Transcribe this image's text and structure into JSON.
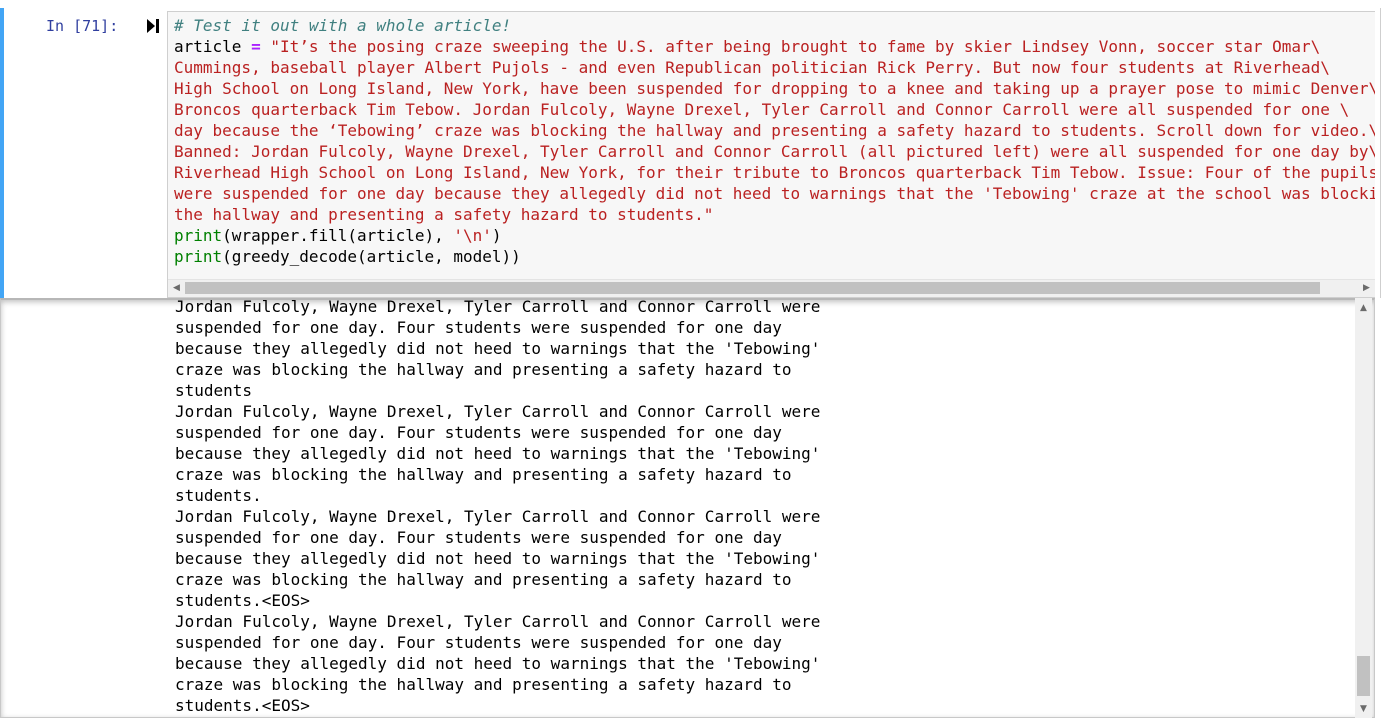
{
  "cell": {
    "prompt": "In [71]:",
    "code_lines": [
      {
        "tokens": [
          {
            "t": "# Test it out with a whole article!",
            "c": "comment"
          }
        ]
      },
      {
        "tokens": [
          {
            "t": "article ",
            "c": ""
          },
          {
            "t": "=",
            "c": "op"
          },
          {
            "t": " \"It’s the posing craze sweeping the U.S. after being brought to fame by skier Lindsey Vonn, soccer star Omar\\",
            "c": "str"
          }
        ]
      },
      {
        "tokens": [
          {
            "t": "Cummings, baseball player Albert Pujols - and even Republican politician Rick Perry. But now four students at Riverhead\\",
            "c": "str"
          }
        ]
      },
      {
        "tokens": [
          {
            "t": "High School on Long Island, New York, have been suspended for dropping to a knee and taking up a prayer pose to mimic Denver\\",
            "c": "str"
          }
        ]
      },
      {
        "tokens": [
          {
            "t": "Broncos quarterback Tim Tebow. Jordan Fulcoly, Wayne Drexel, Tyler Carroll and Connor Carroll were all suspended for one \\",
            "c": "str"
          }
        ]
      },
      {
        "tokens": [
          {
            "t": "day because the ‘Tebowing’ craze was blocking the hallway and presenting a safety hazard to students. Scroll down for video.\\",
            "c": "str"
          }
        ]
      },
      {
        "tokens": [
          {
            "t": "Banned: Jordan Fulcoly, Wayne Drexel, Tyler Carroll and Connor Carroll (all pictured left) were all suspended for one day by\\",
            "c": "str"
          }
        ]
      },
      {
        "tokens": [
          {
            "t": "Riverhead High School on Long Island, New York, for their tribute to Broncos quarterback Tim Tebow. Issue: Four of the pupils\\",
            "c": "str"
          }
        ]
      },
      {
        "tokens": [
          {
            "t": "were suspended for one day because they allegedly did not heed to warnings that the 'Tebowing' craze at the school was blocki",
            "c": "str"
          }
        ]
      },
      {
        "tokens": [
          {
            "t": "the hallway and presenting a safety hazard to students.\"",
            "c": "str"
          }
        ]
      },
      {
        "tokens": [
          {
            "t": "print",
            "c": "builtin"
          },
          {
            "t": "(wrapper.fill(article), ",
            "c": ""
          },
          {
            "t": "'\\n'",
            "c": "str"
          },
          {
            "t": ")",
            "c": ""
          }
        ]
      },
      {
        "tokens": [
          {
            "t": "print",
            "c": "builtin"
          },
          {
            "t": "(greedy_decode(article, model))",
            "c": ""
          }
        ]
      }
    ]
  },
  "output": {
    "lines": [
      "Jordan Fulcoly, Wayne Drexel, Tyler Carroll and Connor Carroll were",
      "suspended for one day. Four students were suspended for one day",
      "because they allegedly did not heed to warnings that the 'Tebowing'",
      "craze was blocking the hallway and presenting a safety hazard to",
      "students",
      "Jordan Fulcoly, Wayne Drexel, Tyler Carroll and Connor Carroll were",
      "suspended for one day. Four students were suspended for one day",
      "because they allegedly did not heed to warnings that the 'Tebowing'",
      "craze was blocking the hallway and presenting a safety hazard to",
      "students.",
      "Jordan Fulcoly, Wayne Drexel, Tyler Carroll and Connor Carroll were",
      "suspended for one day. Four students were suspended for one day",
      "because they allegedly did not heed to warnings that the 'Tebowing'",
      "craze was blocking the hallway and presenting a safety hazard to",
      "students.<EOS>",
      "Jordan Fulcoly, Wayne Drexel, Tyler Carroll and Connor Carroll were",
      "suspended for one day. Four students were suspended for one day",
      "because they allegedly did not heed to warnings that the 'Tebowing'",
      "craze was blocking the hallway and presenting a safety hazard to",
      "students.<EOS>"
    ]
  },
  "icons": {
    "run": "run-cell-icon",
    "scroll_left": "scroll-left-icon",
    "scroll_right": "scroll-right-icon",
    "scroll_up": "scroll-up-icon",
    "scroll_down": "scroll-down-icon"
  },
  "colors": {
    "prompt": "#303f9f",
    "selected_bar": "#42a5f5",
    "comment": "#408080",
    "string": "#ba2121",
    "builtin": "#008000",
    "operator": "#aa22ff"
  }
}
